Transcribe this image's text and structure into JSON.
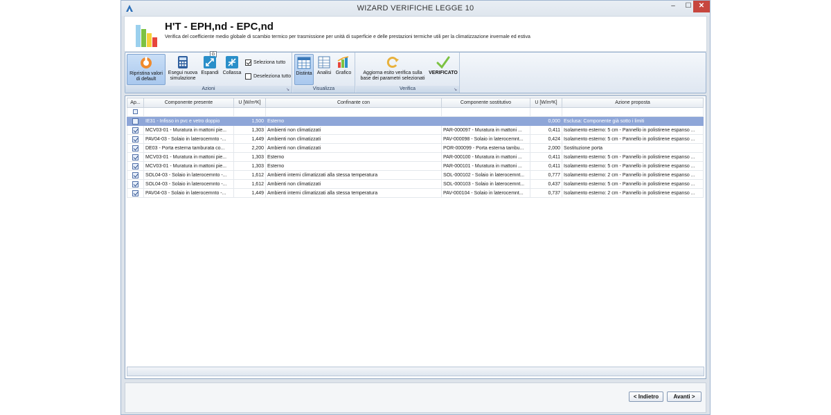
{
  "window": {
    "title": "WIZARD VERIFICHE LEGGE 10",
    "min_label": "–",
    "max_label": "☐",
    "close_label": "✕"
  },
  "header": {
    "title": "H'T - EPH,nd - EPC,nd",
    "subtitle": "Verifica del coefficiente medio globale di scambio termico per trasmissione per unità di superficie e delle prestazioni termiche utili per la climatizzazione invernale ed estiva"
  },
  "ribbon": {
    "groups": {
      "azioni": "Azioni",
      "visualizza": "Visualizza",
      "verifica": "Verifica"
    },
    "buttons": {
      "ripristina": "Ripristina valori di default",
      "esegui": "Esegui nuova simulazione",
      "espandi": "Espandi",
      "collassa": "Collassa",
      "seleziona_tutto": "Seleziona tutto",
      "deseleziona_tutto": "Deseleziona tutto",
      "distinta": "Distinta",
      "analisi": "Analisi",
      "grafico": "Grafico",
      "aggiorna": "Aggiorna esito verifica sulla base dei parametri selezionati",
      "verificato": "VERIFICATO"
    },
    "key_tip": "G"
  },
  "grid": {
    "columns": [
      "Ap...",
      "Componente presente",
      "U [W/m²K]",
      "Confinante con",
      "Componente sostitutivo",
      "U [W/m²K]",
      "Azione proposta"
    ],
    "rows": [
      {
        "checked": false,
        "selected": true,
        "componente": "IE31 - Infisso in pvc e vetro doppio",
        "u": "1,500",
        "confinante": "Esterno",
        "sostitutivo": "",
        "u2": "0,000",
        "azione": "Esclusa: Componente già sotto i limiti"
      },
      {
        "checked": true,
        "selected": false,
        "componente": "MCV03-01 - Muratura in mattoni pie...",
        "u": "1,303",
        "confinante": "Ambienti non climatizzati",
        "sostitutivo": "PAR-000097 - Muratura in mattoni ...",
        "u2": "0,411",
        "azione": "Isolamento esterno: 5 cm - Pannello in polistirene espanso ..."
      },
      {
        "checked": true,
        "selected": false,
        "componente": "PAV04-03 - Solaio in laterocemnto -...",
        "u": "1,449",
        "confinante": "Ambienti non climatizzati",
        "sostitutivo": "PAV-000098 - Solaio in laterocemnt...",
        "u2": "0,424",
        "azione": "Isolamento esterno: 5 cm - Pannello in polistirene espanso ..."
      },
      {
        "checked": true,
        "selected": false,
        "componente": "DE03 - Porta esterna tamburata co...",
        "u": "2,200",
        "confinante": "Ambienti non climatizzati",
        "sostitutivo": "POR-000099 - Porta esterna tambu...",
        "u2": "2,000",
        "azione": "Sostituzione porta"
      },
      {
        "checked": true,
        "selected": false,
        "componente": "MCV03-01 - Muratura in mattoni pie...",
        "u": "1,303",
        "confinante": "Esterno",
        "sostitutivo": "PAR-000100 - Muratura in mattoni ...",
        "u2": "0,411",
        "azione": "Isolamento esterno: 5 cm - Pannello in polistirene espanso ..."
      },
      {
        "checked": true,
        "selected": false,
        "componente": "MCV03-01 - Muratura in mattoni pie...",
        "u": "1,303",
        "confinante": "Esterno",
        "sostitutivo": "PAR-000101 - Muratura in mattoni ...",
        "u2": "0,411",
        "azione": "Isolamento esterno: 5 cm - Pannello in polistirene espanso ..."
      },
      {
        "checked": true,
        "selected": false,
        "componente": "SOL04-03 - Solaio in laterocemnto -...",
        "u": "1,612",
        "confinante": "Ambienti interni climatizzati alla stessa temperatura",
        "sostitutivo": "SOL-000102 - Solaio in laterocemnt...",
        "u2": "0,777",
        "azione": "Isolamento esterno: 2 cm - Pannello in polistirene espanso ..."
      },
      {
        "checked": true,
        "selected": false,
        "componente": "SOL04-03 - Solaio in laterocemnto -...",
        "u": "1,612",
        "confinante": "Ambienti non climatizzati",
        "sostitutivo": "SOL-000103 - Solaio in laterocemnt...",
        "u2": "0,437",
        "azione": "Isolamento esterno: 5 cm - Pannello in polistirene espanso ..."
      },
      {
        "checked": true,
        "selected": false,
        "componente": "PAV04-03 - Solaio in laterocemnto -...",
        "u": "1,449",
        "confinante": "Ambienti interni climatizzati alla stessa temperatura",
        "sostitutivo": "PAV-000104 - Solaio in laterocemnt...",
        "u2": "0,737",
        "azione": "Isolamento esterno: 2 cm - Pannello in polistirene espanso ..."
      }
    ]
  },
  "footer": {
    "back": "< Indietro",
    "next": "Avanti >"
  },
  "colors": {
    "selected_row": "#8ea6d8",
    "ribbon_border": "#9bb4d1",
    "verificato_check": "#7cc242"
  }
}
